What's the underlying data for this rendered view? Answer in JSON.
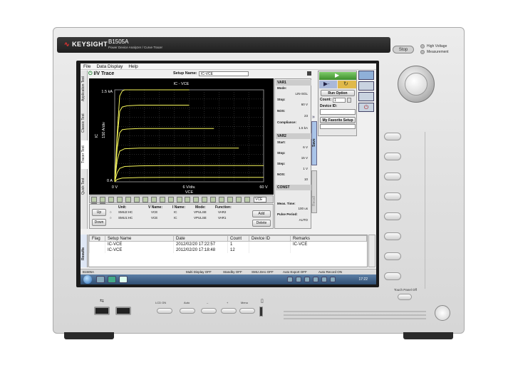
{
  "bezel": {
    "brand": "KEYSIGHT",
    "model": "B1505A",
    "model_desc": "Power Device Analyzer / Curve Tracer",
    "stop_label": "Stop",
    "hv_line1": "High Voltage",
    "hv_line2": "Measurement",
    "touch_panel_off": "Touch Panel Off",
    "front_labels": [
      "LCD ON",
      "Auto",
      "–",
      "+",
      "Menu"
    ]
  },
  "app": {
    "menu": [
      "File",
      "Data Display",
      "Help"
    ],
    "side_tabs": [
      "Application Test",
      "Classic Test",
      "Tracer Test",
      "Quick Test"
    ],
    "title": "I/V Trace",
    "setup_name_label": "Setup Name:",
    "setup_name_value": "IC-VCE"
  },
  "chart_data": {
    "type": "line",
    "title": "IC - VCE",
    "xlabel": "VCE",
    "ylabel": "IC",
    "y_top_label": "1.5 kA",
    "y_bottom_label": "0 A",
    "y_div_label": "150 A/div",
    "x_left_label": "0 V",
    "x_mid_label": "6 V/div.",
    "x_right_label": "60 V",
    "xlim": [
      0,
      60
    ],
    "ylim": [
      0,
      1500
    ],
    "grid": true,
    "series": [
      {
        "x": [
          0,
          1,
          2,
          3,
          4,
          6,
          10,
          20,
          30
        ],
        "values": [
          0,
          800,
          1400,
          1480,
          1500,
          1500,
          1500,
          1500,
          1500
        ]
      },
      {
        "x": [
          0,
          1,
          2,
          3,
          5,
          10,
          20,
          30
        ],
        "values": [
          0,
          700,
          1150,
          1220,
          1240,
          1250,
          1250,
          1250
        ]
      },
      {
        "x": [
          0,
          1,
          2,
          3,
          5,
          10,
          20,
          30,
          40
        ],
        "values": [
          0,
          550,
          800,
          850,
          860,
          870,
          870,
          870,
          870
        ]
      },
      {
        "x": [
          0,
          1,
          2,
          4,
          10,
          20,
          30,
          40,
          50
        ],
        "values": [
          0,
          350,
          500,
          540,
          550,
          550,
          550,
          550,
          550
        ]
      },
      {
        "x": [
          0,
          1,
          2,
          4,
          10,
          20,
          30,
          40,
          50,
          60
        ],
        "values": [
          0,
          150,
          220,
          250,
          260,
          265,
          265,
          265,
          265,
          265
        ]
      },
      {
        "x": [
          0,
          1,
          3,
          10,
          20,
          30,
          40,
          50,
          60
        ],
        "values": [
          0,
          40,
          60,
          70,
          72,
          72,
          72,
          72,
          72
        ]
      }
    ],
    "colors": {
      "trace": "#f4f45a",
      "grid": "#555555",
      "axis_text": "#ffffff"
    }
  },
  "unit_panel": {
    "headers": [
      "Unit:",
      "V Name:",
      "I Name:",
      "Mode:",
      "Function:"
    ],
    "rows": [
      {
        "unit": "SMU2:HC",
        "vname": "VCE",
        "iname": "IC",
        "mode": "VPULSE",
        "func": "VAR2"
      },
      {
        "unit": "SMU1:HC",
        "vname": "VCE",
        "iname": "IC",
        "mode": "VPULSE",
        "func": "VAR1"
      }
    ],
    "btn_up": "Up",
    "btn_down": "Down",
    "btn_add": "Add",
    "btn_delete": "Delete",
    "meas_time_label": "Meas. Time:",
    "meas_time_value": "100 us",
    "pulse_period_label": "Pulse Period:",
    "pulse_period_value": "AUTO",
    "ctl_selector": "VCE"
  },
  "var1": {
    "header": "VAR1",
    "mode_label": "Mode:",
    "mode_value": "LIN-SGL",
    "stop_label": "Stop:",
    "stop_value": "60 V",
    "nos_label": "NOS:",
    "nos_value": "23",
    "compliance_label": "Compliance:",
    "compliance_value": "1.5 kA"
  },
  "var2": {
    "header": "VAR2",
    "start_label": "Start:",
    "start_value": "6 V",
    "stop_label": "Stop:",
    "stop_value": "15 V",
    "step_label": "Step:",
    "step_value": "1 V",
    "nos_label": "NOS:",
    "nos_value": "10"
  },
  "const": {
    "header": "CONST"
  },
  "side_bars": {
    "save": "Save",
    "recall": "Recall"
  },
  "right_ctrl": {
    "run_option": "Run Option",
    "count_label": "Count:",
    "count_value": "1",
    "device_id_label": "Device ID:",
    "device_id_value": "",
    "favorite": "My Favorite Setup"
  },
  "results": {
    "tab_label": "Results",
    "headers": [
      "Flag",
      "Setup Name",
      "Date",
      "Count",
      "Device ID",
      "Remarks"
    ],
    "rows": [
      [
        "",
        "IC-VCE",
        "2012/02/20 17:22:57",
        "1",
        "",
        "IC-VCE"
      ],
      [
        "",
        "IC-VCE",
        "2012/02/20 17:18:48",
        "12",
        "",
        ""
      ]
    ]
  },
  "statusbar": {
    "left": "B1505A",
    "items": [
      "Multi Display OFF",
      "Standby OFF",
      "SMU Zero OFF",
      "Auto Export OFF",
      "Auto Record ON"
    ]
  },
  "taskbar": {
    "clock": "17:22"
  }
}
